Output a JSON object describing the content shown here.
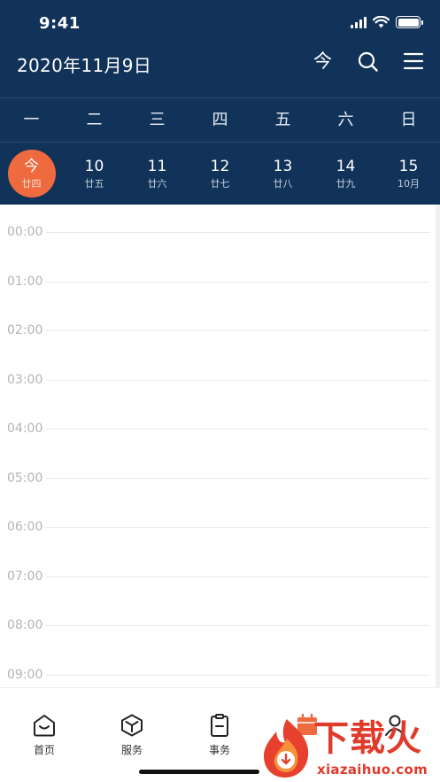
{
  "status_bar": {
    "time": "9:41"
  },
  "header": {
    "title": "2020年11月9日",
    "today_button": "今"
  },
  "weekdays": [
    "一",
    "二",
    "三",
    "四",
    "五",
    "六",
    "日"
  ],
  "dates": [
    {
      "num": "今",
      "lunar": "廿四",
      "today": true
    },
    {
      "num": "10",
      "lunar": "廿五"
    },
    {
      "num": "11",
      "lunar": "廿六"
    },
    {
      "num": "12",
      "lunar": "廿七"
    },
    {
      "num": "13",
      "lunar": "廿八"
    },
    {
      "num": "14",
      "lunar": "廿九"
    },
    {
      "num": "15",
      "lunar": "10月"
    }
  ],
  "hours": [
    "00:00",
    "01:00",
    "02:00",
    "03:00",
    "04:00",
    "05:00",
    "06:00",
    "07:00",
    "08:00",
    "09:00"
  ],
  "tabs": [
    {
      "label": "首页",
      "icon": "home-icon"
    },
    {
      "label": "服务",
      "icon": "cube-icon"
    },
    {
      "label": "事务",
      "icon": "clipboard-icon"
    },
    {
      "label": "",
      "icon": "calendar-icon"
    },
    {
      "label": "",
      "icon": "user-icon"
    }
  ],
  "watermark": {
    "text": "下载火",
    "url": "xiazaihuo.com"
  },
  "colors": {
    "header_bg": "#123359",
    "accent": "#ef6a3f",
    "watermark": "#e03a2b"
  }
}
